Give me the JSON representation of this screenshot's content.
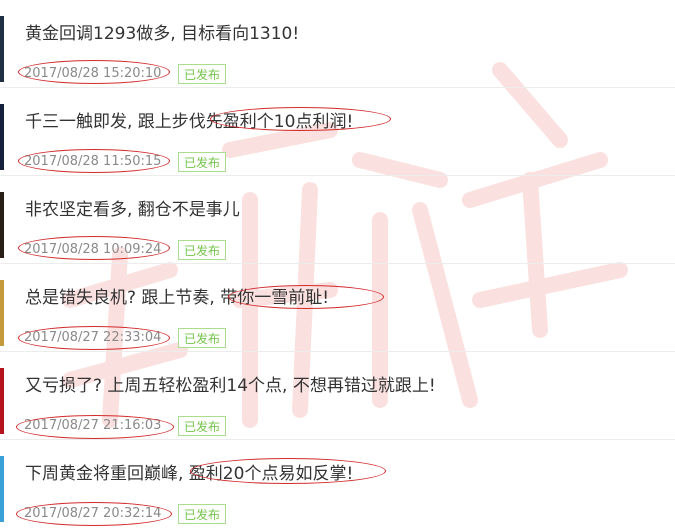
{
  "items": [
    {
      "title": "黄金回调1293做多, 目标看向1310!",
      "date": "2017/08/28 15:20:10",
      "status": "已发布",
      "thumb_color": "#1f2f44"
    },
    {
      "title": "千三一触即发, 跟上步伐先盈利个10点利润!",
      "date": "2017/08/28 11:50:15",
      "status": "已发布",
      "thumb_color": "#15203a"
    },
    {
      "title": "非农坚定看多, 翻仓不是事儿",
      "date": "2017/08/28 10:09:24",
      "status": "已发布",
      "thumb_color": "#2a1f18"
    },
    {
      "title": "总是错失良机? 跟上节奏, 带你一雪前耻!",
      "date": "2017/08/27 22:33:04",
      "status": "已发布",
      "thumb_color": "#c49b3a"
    },
    {
      "title": "又亏损了? 上周五轻松盈利14个点, 不想再错过就跟上!",
      "date": "2017/08/27 21:16:03",
      "status": "已发布",
      "thumb_color": "#b5121b"
    },
    {
      "title": "下周黄金将重回巅峰, 盈利20个点易如反掌!",
      "date": "2017/08/27 20:32:14",
      "status": "已发布",
      "thumb_color": "#3aa0d8"
    }
  ],
  "colors": {
    "annotation": "#d22a2a",
    "badge_text": "#73c44a",
    "watermark": "#f6d5d5"
  }
}
